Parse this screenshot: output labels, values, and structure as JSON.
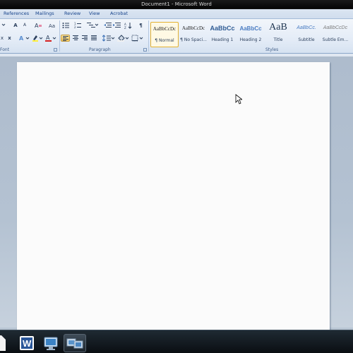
{
  "window": {
    "title": "Document1 - Microsoft Word"
  },
  "ribbon_tabs": [
    "References",
    "Mailings",
    "Review",
    "View",
    "Acrobat"
  ],
  "groups": {
    "font_label": "Font",
    "paragraph_label": "Paragraph",
    "styles_label": "Styles"
  },
  "font_group": {
    "grow_font": "A",
    "shrink_font": "A",
    "subscript": "x",
    "superscript": "x"
  },
  "paragraph_group": {
    "show_marks": "¶"
  },
  "styles": [
    {
      "preview": "AaBbCcDc",
      "name": "¶ Normal",
      "selected": true
    },
    {
      "preview": "AaBbCcDc",
      "name": "¶ No Spaci..."
    },
    {
      "preview": "AaBbCc",
      "name": "Heading 1"
    },
    {
      "preview": "AaBbCc",
      "name": "Heading 2"
    },
    {
      "preview": "AaB",
      "name": "Title"
    },
    {
      "preview": "AaBbCc.",
      "name": "Subtitle"
    },
    {
      "preview": "AaBbCcDc",
      "name": "Subtle Em..."
    }
  ],
  "colors": {
    "selected_style_border": "#e2b133",
    "ribbon_text": "#15428b",
    "font_color_underline": "#d42020",
    "highlight_underline": "#ffef3a"
  },
  "taskbar": {
    "items": [
      {
        "icon": "word-icon",
        "active": false
      },
      {
        "icon": "network-icon",
        "active": false
      },
      {
        "icon": "computer-icon",
        "active": true
      }
    ]
  }
}
